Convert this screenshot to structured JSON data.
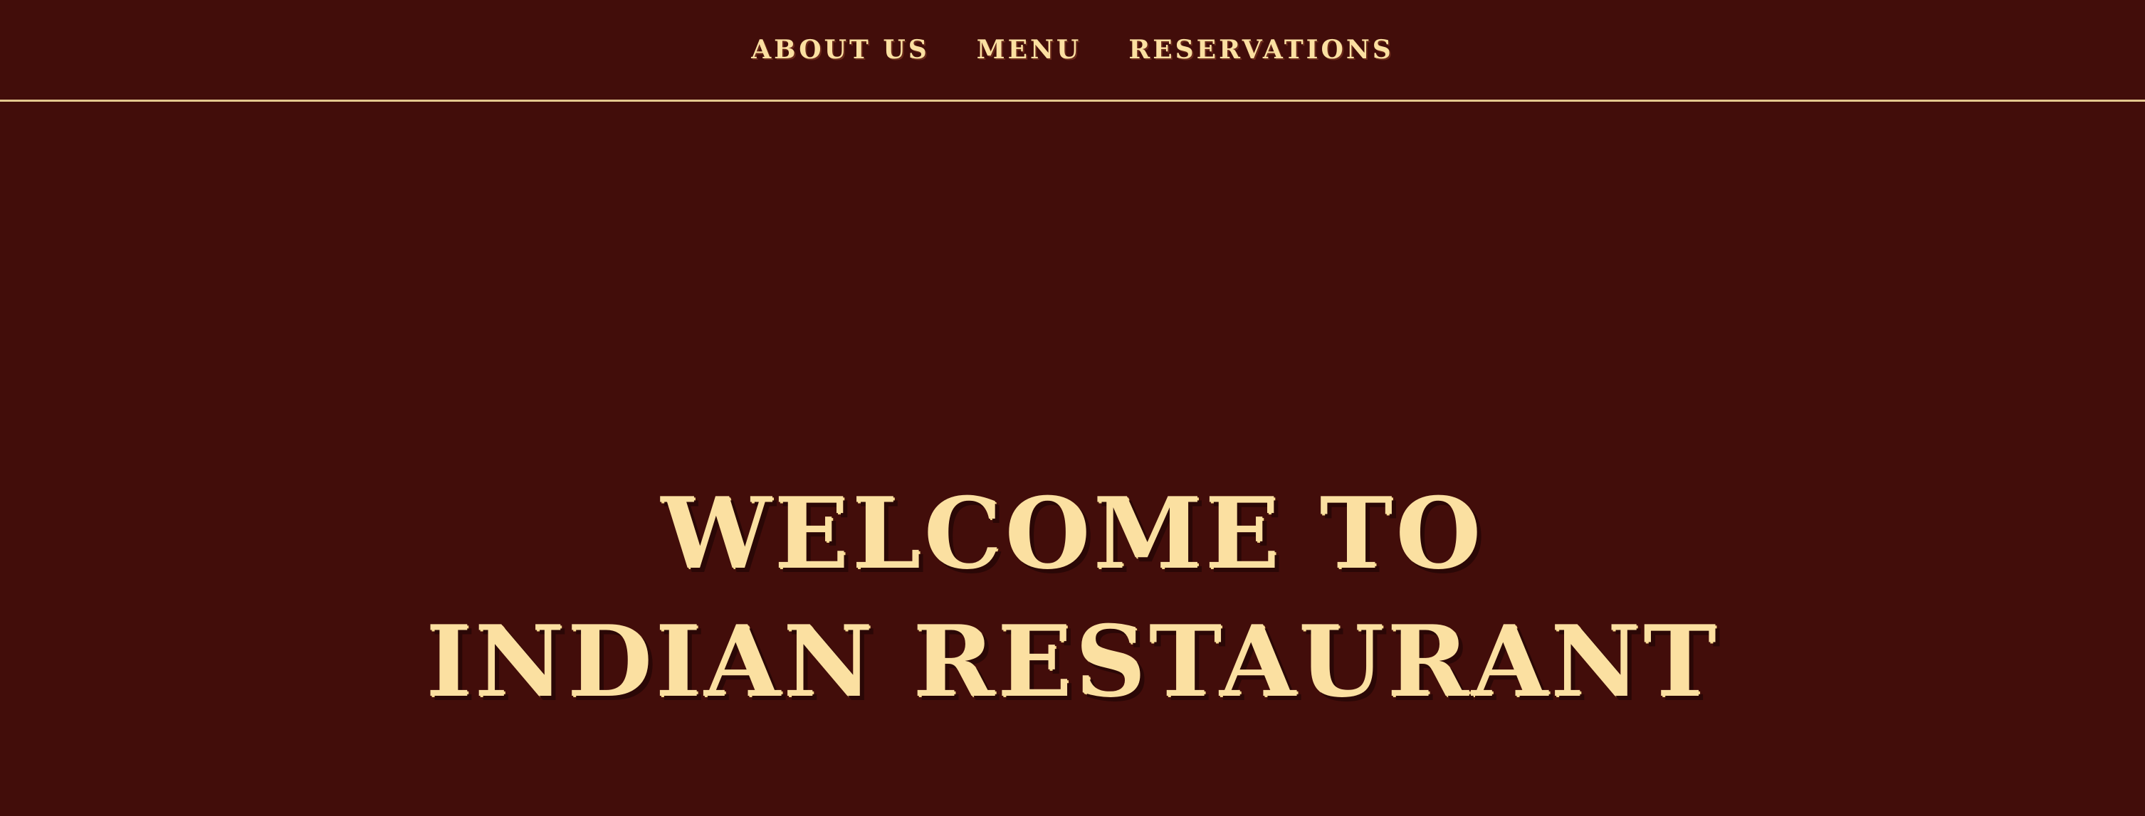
{
  "nav": {
    "items": [
      {
        "label": "ABOUT US"
      },
      {
        "label": "MENU"
      },
      {
        "label": "RESERVATIONS"
      }
    ]
  },
  "hero": {
    "line1": "WELCOME TO",
    "line2": "INDIAN RESTAURANT"
  },
  "colors": {
    "background": "#420d0a",
    "text": "#fbe0a1",
    "divider": "#e4c78f"
  }
}
